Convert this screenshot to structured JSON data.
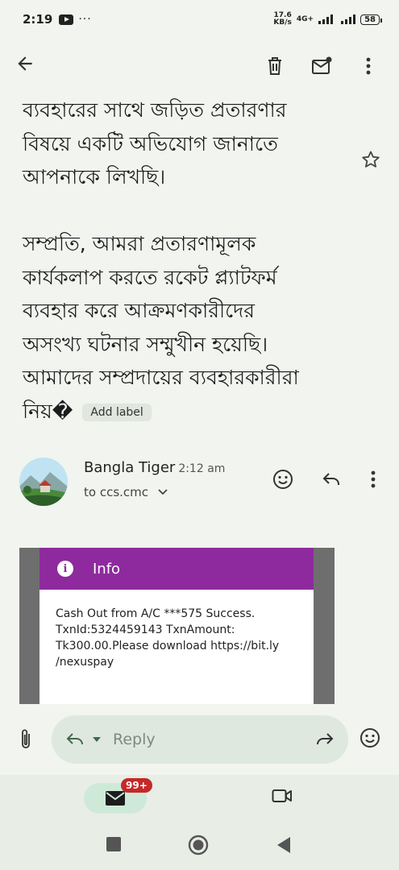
{
  "status_bar": {
    "time": "2:19",
    "more_dots": "···",
    "speed_value": "17.6",
    "speed_unit": "KB/s",
    "network": "4G+",
    "battery": "58"
  },
  "toolbar": {
    "back_icon": "arrow-left-icon",
    "delete_icon": "trash-icon",
    "mark_unread_icon": "mail-unread-icon",
    "more_icon": "more-vertical-icon"
  },
  "message_body": {
    "lines_para1": [
      "ব্যবহারের সাথে জড়িত প্রতারণার",
      "বিষয়ে একটি অভিযোগ জানাতে",
      "আপনাকে লিখছি।"
    ],
    "lines_para2": [
      "সম্প্রতি, আমরা প্রতারণামূলক",
      "কার্যকলাপ করতে রকেট প্ল্যাটফর্ম",
      "ব্যবহার করে আক্রমণকারীদের",
      "অসংখ্য ঘটনার সম্মুখীন হয়েছি।",
      "আমাদের সম্প্রদায়ের ব্যবহারকারীরা"
    ],
    "last_line": "নিয়�",
    "add_label": "Add label"
  },
  "sender": {
    "name": "Bangla Tiger",
    "time": "2:12 am",
    "recipient": "to ccs.cmc"
  },
  "embedded_screenshot": {
    "header": "Info",
    "body": "Cash Out from A/C ***575 Success. TxnId:5324459143 TxnAmount: Tk300.00.Please download https://bit.ly /nexuspay"
  },
  "reply_bar": {
    "placeholder": "Reply"
  },
  "bottom_nav": {
    "mail_badge": "99+"
  },
  "colors": {
    "background": "#f1f4ef",
    "info_header": "#8e2a9e",
    "reply_pill": "#dfe8df",
    "badge": "#c62828"
  }
}
